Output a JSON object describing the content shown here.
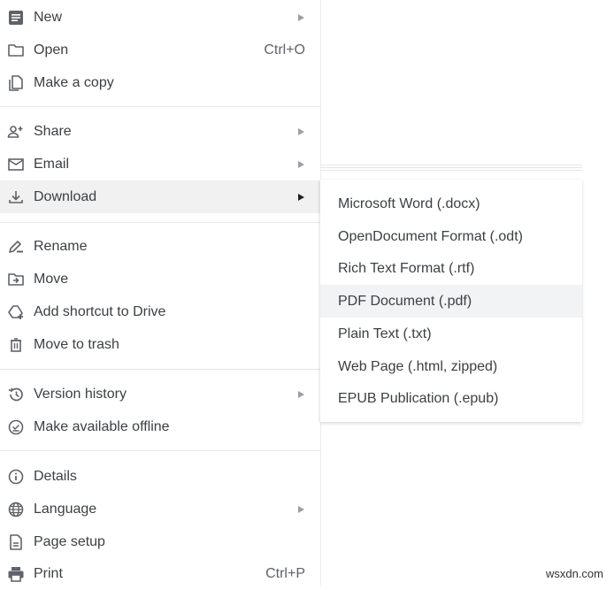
{
  "file_menu": {
    "items": [
      {
        "label": "New",
        "icon": "doc-icon",
        "submenu": true
      },
      {
        "label": "Open",
        "icon": "folder-icon",
        "shortcut": "Ctrl+O"
      },
      {
        "label": "Make a copy",
        "icon": "copy-icon"
      },
      {
        "label": "Share",
        "icon": "person-add-icon",
        "submenu": true
      },
      {
        "label": "Email",
        "icon": "mail-icon",
        "submenu": true
      },
      {
        "label": "Download",
        "icon": "download-icon",
        "submenu": true,
        "active": true
      },
      {
        "label": "Rename",
        "icon": "rename-icon"
      },
      {
        "label": "Move",
        "icon": "move-folder-icon"
      },
      {
        "label": "Add shortcut to Drive",
        "icon": "drive-shortcut-icon"
      },
      {
        "label": "Move to trash",
        "icon": "trash-icon"
      },
      {
        "label": "Version history",
        "icon": "history-icon",
        "submenu": true
      },
      {
        "label": "Make available offline",
        "icon": "offline-check-icon"
      },
      {
        "label": "Details",
        "icon": "info-icon"
      },
      {
        "label": "Language",
        "icon": "globe-icon",
        "submenu": true
      },
      {
        "label": "Page setup",
        "icon": "page-icon"
      },
      {
        "label": "Print",
        "icon": "printer-icon",
        "shortcut": "Ctrl+P"
      }
    ]
  },
  "download_submenu": {
    "items": [
      {
        "label": "Microsoft Word (.docx)"
      },
      {
        "label": "OpenDocument Format (.odt)"
      },
      {
        "label": "Rich Text Format (.rtf)"
      },
      {
        "label": "PDF Document (.pdf)",
        "hover": true
      },
      {
        "label": "Plain Text (.txt)"
      },
      {
        "label": "Web Page (.html, zipped)"
      },
      {
        "label": "EPUB Publication (.epub)"
      }
    ]
  },
  "watermark": "wsxdn.com"
}
